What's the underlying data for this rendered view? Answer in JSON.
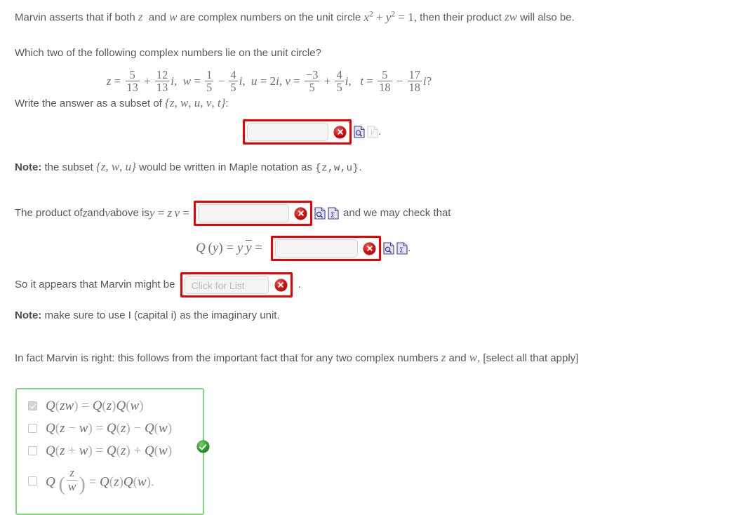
{
  "problem": {
    "intro_1": "Marvin asserts that if both ",
    "intro_var_z": "z",
    "intro_2": " and ",
    "intro_var_w": "w",
    "intro_3": " are complex numbers on the unit circle ",
    "unit_circle_eq": "x^2 + y^2 = 1,",
    "intro_4": " then their product ",
    "intro_var_zw": "zw",
    "intro_5": " will also be.",
    "question": "Which two of the following complex numbers lie on the unit circle?",
    "choices_expr": "z = 5/13 + (12/13)i,  w = 1/5 - (4/5)i,  u = 2i, v = -3/5 + (4/5)i,  t = 5/18 - (17/18)i?",
    "write_answer_prefix": "Write the answer as a subset of ",
    "write_answer_set": "{z, w, u, v, t}",
    "write_answer_suffix": ":",
    "note_1_label": "Note:",
    "note_1_text_a": " the subset ",
    "note_1_set": "{z, w, u}",
    "note_1_text_b": " would be written in Maple notation as ",
    "note_1_maple": "{z,w,u}",
    "note_1_period": ".",
    "product_line_a": "The product of ",
    "product_var_z": "z",
    "product_line_b": " and ",
    "product_var_v": "v",
    "product_line_c": " above is ",
    "product_eq": "y = z v =",
    "product_line_d": "and we may check that",
    "q_identity": "Q (y) = y ȳ =",
    "appears_text": "So it appears that Marvin might be",
    "appears_period": ".",
    "note_2_label": "Note:",
    "note_2_text": " make sure to use I (capital i) as the imaginary unit.",
    "conclusion_a": "In fact Marvin is right: this follows from the important fact that for any two complex numbers ",
    "conclusion_var_z": "z",
    "conclusion_b": " and ",
    "conclusion_var_w": "w",
    "conclusion_c": ", [select all that apply]"
  },
  "fractions": {
    "z_re": {
      "n": "5",
      "d": "13"
    },
    "z_im": {
      "n": "12",
      "d": "13"
    },
    "w_re": {
      "n": "1",
      "d": "5"
    },
    "w_im": {
      "n": "4",
      "d": "5"
    },
    "u_val": "2i",
    "v_re": {
      "n": "−3",
      "d": "5"
    },
    "v_im": {
      "n": "4",
      "d": "5"
    },
    "t_re": {
      "n": "5",
      "d": "18"
    },
    "t_im": {
      "n": "17",
      "d": "18"
    }
  },
  "answers": [
    {
      "name": "subset-answer",
      "value": "",
      "placeholder": "",
      "status": "incorrect",
      "preview_icon": "page-magnifier-icon",
      "secondary_icon": "page-p-icon-disabled"
    },
    {
      "name": "product-answer",
      "value": "",
      "placeholder": "",
      "status": "incorrect",
      "preview_icon": "page-magnifier-icon",
      "secondary_icon": "page-sigma-icon"
    },
    {
      "name": "norm-answer",
      "value": "",
      "placeholder": "",
      "status": "incorrect",
      "preview_icon": "page-magnifier-icon",
      "secondary_icon": "page-sigma-icon"
    }
  ],
  "list_widget": {
    "placeholder": "Click for List",
    "value": "",
    "status": "incorrect"
  },
  "checkbox_group": {
    "status": "correct",
    "status_icon": "green-check-badge",
    "options": [
      {
        "id": "opt-a",
        "checked": true,
        "label": "Q(zw) = Q(z)Q(w)"
      },
      {
        "id": "opt-b",
        "checked": false,
        "label": "Q(z - w) = Q(z) - Q(w)"
      },
      {
        "id": "opt-c",
        "checked": false,
        "label": "Q(z + w) = Q(z) + Q(w)"
      },
      {
        "id": "opt-d",
        "checked": false,
        "label": "Q (z/w) = Q(z)Q(w)."
      }
    ]
  },
  "colors": {
    "error_border": "#ee0000",
    "error_badge": "#d81010",
    "success_border": "#7ed97e",
    "success_badge": "#2f9e28",
    "text": "#55595c",
    "math_text": "#6b7079",
    "input_bg": "#f4f4f4",
    "placeholder": "#b6bcc2"
  }
}
